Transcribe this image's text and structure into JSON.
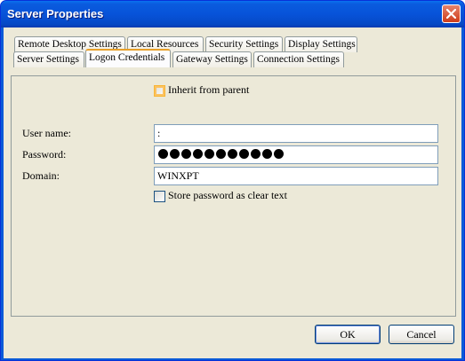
{
  "window": {
    "title": "Server Properties",
    "close_icon": "close-icon"
  },
  "tabs_row1": [
    "Remote Desktop Settings",
    "Local Resources",
    "Security Settings",
    "Display Settings"
  ],
  "tabs_row2": [
    "Server Settings",
    "Logon Credentials",
    "Gateway Settings",
    "Connection Settings"
  ],
  "selected_tab": "Logon Credentials",
  "form": {
    "inherit_label": "Inherit from parent",
    "username_label": "User name:",
    "username_value": ":",
    "password_label": "Password:",
    "password_mask_count": 11,
    "domain_label": "Domain:",
    "domain_value": "WINXPT",
    "store_clear_label": "Store password as clear text"
  },
  "buttons": {
    "ok": "OK",
    "cancel": "Cancel"
  },
  "colors": {
    "title_bar": "#0a5bde",
    "dialog_bg": "#ece9d8",
    "selected_tab_accent": "#e8a029"
  }
}
